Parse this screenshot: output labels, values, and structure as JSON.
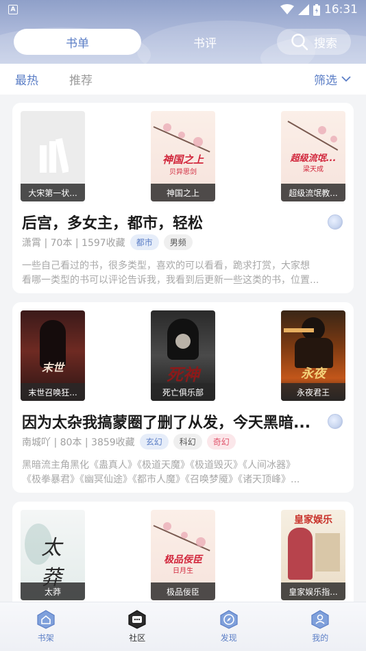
{
  "status_bar": {
    "time": "16:31",
    "app_icon": "A"
  },
  "tabs": {
    "booklist": "书单",
    "review": "书评",
    "search": "搜索"
  },
  "subbar": {
    "hot": "最热",
    "recommend": "推荐",
    "filter": "筛选"
  },
  "cards": [
    {
      "covers": [
        {
          "caption": "大宋第一状...",
          "style": "placeholder"
        },
        {
          "caption": "神国之上",
          "title": "神国之上",
          "author": "贝异思剑",
          "style": "peach"
        },
        {
          "caption": "超级流氓教...",
          "title": "超级流氓...",
          "author": "梁天成",
          "style": "peach"
        }
      ],
      "title": "后宫，多女主，都市，轻松",
      "meta": "潇霄 | 70本 | 1597收藏",
      "tags": [
        {
          "label": "都市",
          "color": "blue"
        },
        {
          "label": "男频",
          "color": "gray"
        }
      ],
      "desc": [
        "一些自己看过的书，很多类型，喜欢的可以看看，跪求打赏，大家想",
        "看哪一类型的书可以评论告诉我，我看到后更新一些这类的书，位置..."
      ]
    },
    {
      "covers": [
        {
          "caption": "末世召唤狂...",
          "style": "dark-red"
        },
        {
          "caption": "死亡俱乐部",
          "style": "dark-gray"
        },
        {
          "caption": "永夜君王",
          "style": "dark-fire"
        }
      ],
      "title": "因为太杂我搞蒙圈了删了从发，今天黑暗...",
      "meta": "南城吖 | 80本 | 3859收藏",
      "tags": [
        {
          "label": "玄幻",
          "color": "blue"
        },
        {
          "label": "科幻",
          "color": "gray"
        },
        {
          "label": "奇幻",
          "color": "pink"
        }
      ],
      "desc": [
        "黑暗流主角黑化《蛊真人》《极道天魔》《极道毁灭》《人间冰器》",
        "《极拳暴君》《幽冥仙途》《都市人魔》《召唤梦魇》《诸天顶峰》..."
      ]
    },
    {
      "covers": [
        {
          "caption": "太莽",
          "title": "太莽",
          "style": "ink"
        },
        {
          "caption": "极品佞臣",
          "title": "极品佞臣",
          "author": "日月生",
          "style": "peach"
        },
        {
          "caption": "皇家娱乐指...",
          "title": "皇家娱乐",
          "style": "magazine"
        }
      ]
    }
  ],
  "nav": {
    "bookshelf": "书架",
    "community": "社区",
    "discover": "发现",
    "mine": "我的"
  },
  "colors": {
    "accent": "#5b7ec6",
    "header": "#a9b6d8",
    "tag_pink": "#e0526a"
  }
}
